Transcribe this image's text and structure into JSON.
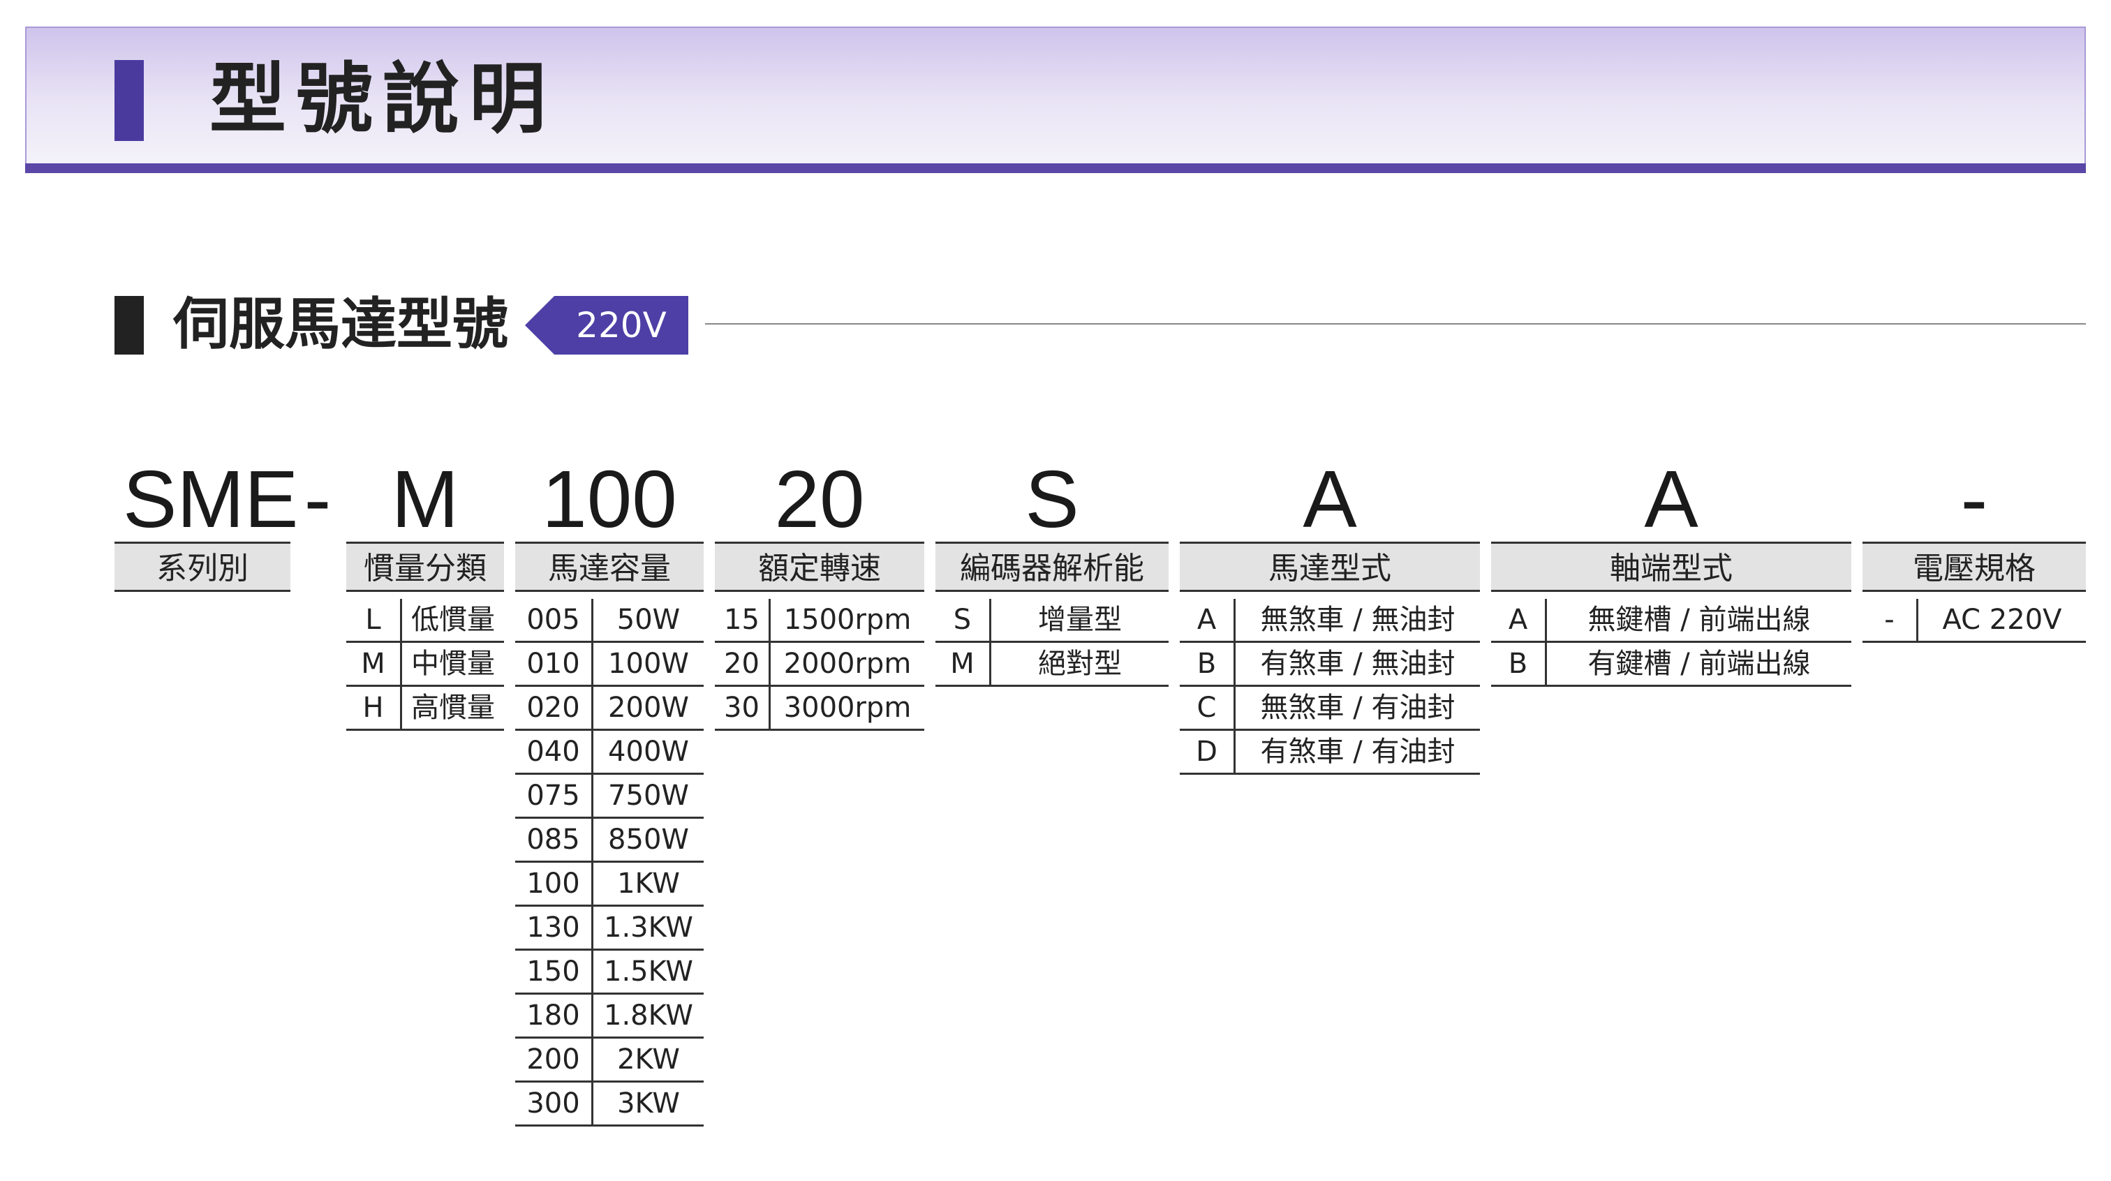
{
  "page_title": "型號說明",
  "subtitle": "伺服馬達型號",
  "voltage_tag": "220V",
  "code": {
    "sme": "SME",
    "dash1": "-",
    "m": "M",
    "n100": "100",
    "n20": "20",
    "s": "S",
    "a1": "A",
    "a2": "A",
    "dash2": "-"
  },
  "headers": {
    "series": "系列別",
    "inertia": "慣量分類",
    "capacity": "馬達容量",
    "speed": "額定轉速",
    "encoder": "編碼器解析能",
    "motor_type": "馬達型式",
    "shaft": "軸端型式",
    "voltage": "電壓規格"
  },
  "inertia": [
    {
      "k": "L",
      "v": "低慣量"
    },
    {
      "k": "M",
      "v": "中慣量"
    },
    {
      "k": "H",
      "v": "高慣量"
    }
  ],
  "capacity": [
    {
      "k": "005",
      "v": "50W"
    },
    {
      "k": "010",
      "v": "100W"
    },
    {
      "k": "020",
      "v": "200W"
    },
    {
      "k": "040",
      "v": "400W"
    },
    {
      "k": "075",
      "v": "750W"
    },
    {
      "k": "085",
      "v": "850W"
    },
    {
      "k": "100",
      "v": "1KW"
    },
    {
      "k": "130",
      "v": "1.3KW"
    },
    {
      "k": "150",
      "v": "1.5KW"
    },
    {
      "k": "180",
      "v": "1.8KW"
    },
    {
      "k": "200",
      "v": "2KW"
    },
    {
      "k": "300",
      "v": "3KW"
    }
  ],
  "speed": [
    {
      "k": "15",
      "v": "1500rpm"
    },
    {
      "k": "20",
      "v": "2000rpm"
    },
    {
      "k": "30",
      "v": "3000rpm"
    }
  ],
  "encoder": [
    {
      "k": "S",
      "v": "增量型"
    },
    {
      "k": "M",
      "v": "絕對型"
    }
  ],
  "motor_type": [
    {
      "k": "A",
      "v": "無煞車 / 無油封"
    },
    {
      "k": "B",
      "v": "有煞車 / 無油封"
    },
    {
      "k": "C",
      "v": "無煞車 / 有油封"
    },
    {
      "k": "D",
      "v": "有煞車 / 有油封"
    }
  ],
  "shaft": [
    {
      "k": "A",
      "v": "無鍵槽 / 前端出線"
    },
    {
      "k": "B",
      "v": "有鍵槽 / 前端出線"
    }
  ],
  "voltage": [
    {
      "k": "-",
      "v": "AC 220V"
    }
  ],
  "colors": {
    "accent": "#4d3fa6",
    "banner_line": "#5a47a8",
    "header_bg": "#e3e3e3"
  }
}
